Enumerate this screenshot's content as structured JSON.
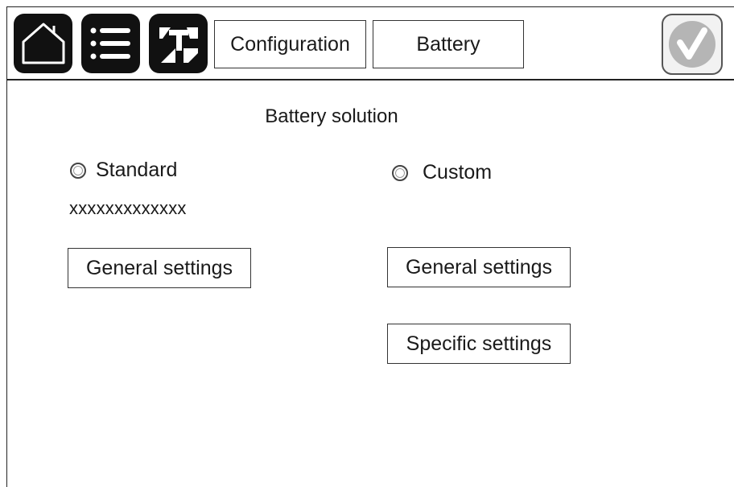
{
  "toolbar": {
    "home_icon": "home-icon",
    "menu_icon": "menu-icon",
    "tools_icon": "maintenance-icon",
    "confirm_icon": "checkmark-icon"
  },
  "breadcrumbs": [
    "Configuration",
    "Battery"
  ],
  "main": {
    "title": "Battery solution",
    "standard": {
      "radio_label": "Standard",
      "selected": false,
      "value": "xxxxxxxxxxxxx",
      "general_button": "General settings"
    },
    "custom": {
      "radio_label": "Custom",
      "selected": false,
      "general_button": "General settings",
      "specific_button": "Specific settings"
    }
  },
  "colors": {
    "icon_button_bg": "#111111",
    "confirm_bg": "#f2f2f2",
    "confirm_check": "#b5b5b5"
  }
}
